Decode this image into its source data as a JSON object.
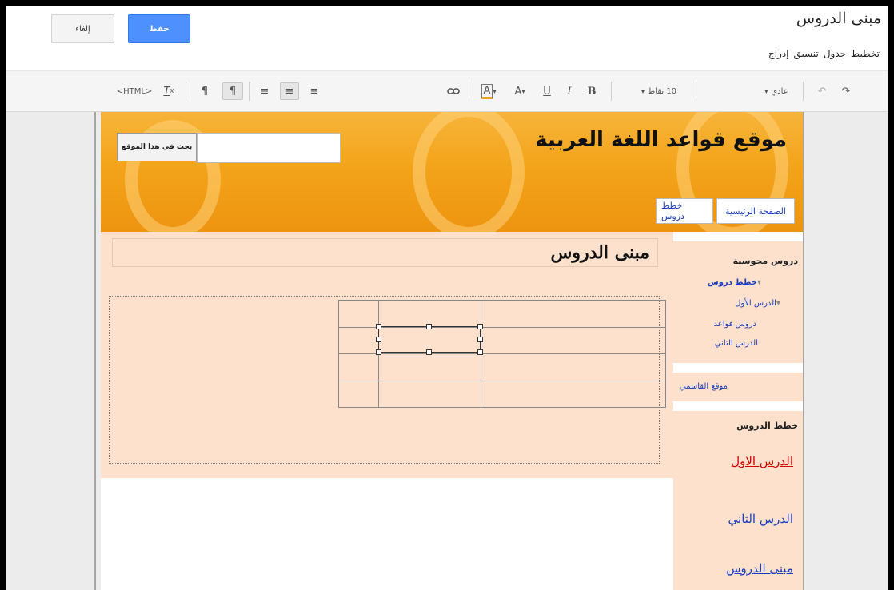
{
  "topbar": {
    "cancel_label": "إلغاء",
    "save_label": "حفظ",
    "page_title": "مبنى الدروس",
    "menu": [
      "إدراج",
      "تنسيق",
      "جدول",
      "تخطيط"
    ]
  },
  "toolbar": {
    "html_label": "<HTML>",
    "font_size": "10 نقاط",
    "style": "عادي",
    "link_icon": "link-icon",
    "bold_label": "B",
    "italic_label": "I",
    "underline_label": "U",
    "text_color_label": "A",
    "highlight_label": "A",
    "clear_format_label": "T"
  },
  "site": {
    "title": "موقع قواعد اللغة العربية",
    "search_button": "بحث في هذا الموقع",
    "nav": [
      "الصفحة الرئيسية",
      "خطط دروس"
    ]
  },
  "content": {
    "heading": "مبنى الدروس"
  },
  "sidebar": {
    "box1_heading": "دروس محوسبة",
    "box1_items": [
      "خطط دروس",
      "الدرس الأول",
      "دروس قواعد",
      "الدرس الثاني"
    ],
    "box2_item": "موقع القاسمي",
    "box3_heading": "خطط الدروس",
    "box3_links": [
      "الدرس الاول",
      "الدرس الثاني",
      "مبنى الدروس"
    ],
    "colors": {
      "link_red": "#d40000",
      "link_blue": "#1a3cbe"
    }
  }
}
